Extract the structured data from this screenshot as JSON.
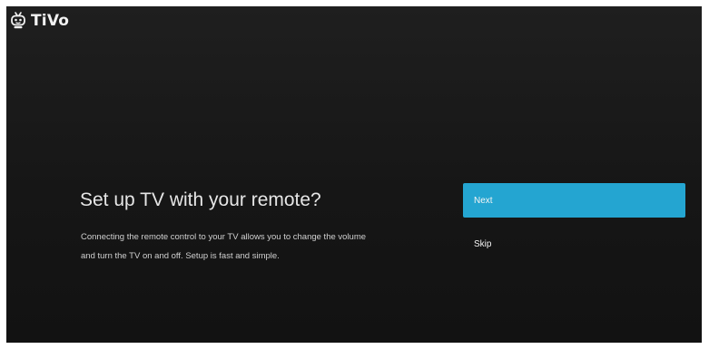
{
  "brand": {
    "name": "TiVo",
    "icon": "tivo-logo-icon"
  },
  "dialog": {
    "title": "Set up TV with your remote?",
    "description": "Connecting the remote control to your TV allows you to change the volume and turn the TV on and off. Setup is fast and simple."
  },
  "actions": {
    "next_label": "Next",
    "skip_label": "Skip",
    "focused": "Next"
  },
  "colors": {
    "background": "#161616",
    "accent": "#24a5d1",
    "text": "#e6e6e6"
  }
}
